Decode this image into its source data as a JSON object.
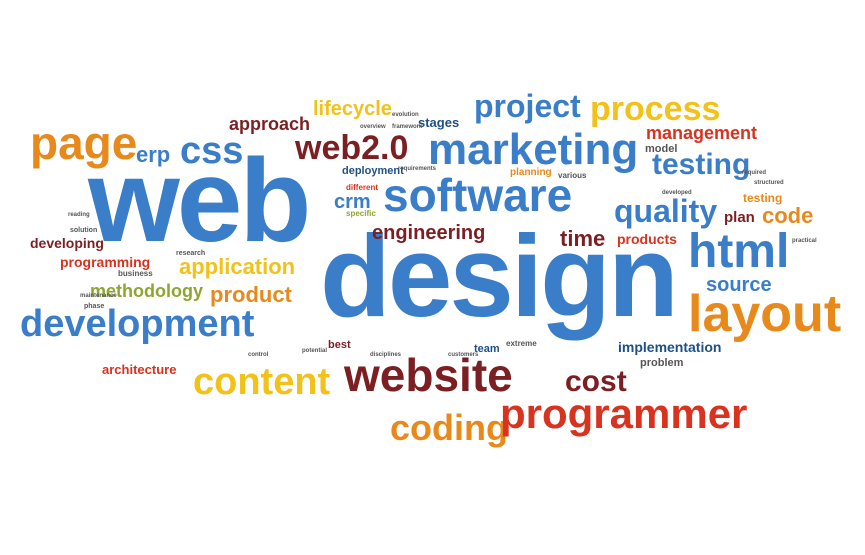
{
  "colors": {
    "blue": "#3a7dc9",
    "dark_red": "#7b1f22",
    "red": "#d9321f",
    "orange": "#e8891c",
    "yellow": "#f2c21a",
    "green": "#8fa531",
    "dark_blue": "#1f4f86",
    "gray": "#555555"
  },
  "words": {
    "web": "web",
    "design": "design",
    "website": "website",
    "software": "software",
    "marketing": "marketing",
    "project": "project",
    "process": "process",
    "lifecycle": "lifecycle",
    "approach": "approach",
    "stages": "stages",
    "management": "management",
    "page": "page",
    "erp": "erp",
    "css": "css",
    "web20": "web2.0",
    "deployment": "deployment",
    "testing": "testing",
    "testing_small": "testing",
    "model": "model",
    "crm": "crm",
    "quality": "quality",
    "code": "code",
    "plan": "plan",
    "engineering": "engineering",
    "time": "time",
    "products": "products",
    "html": "html",
    "source": "source",
    "layout": "layout",
    "developing": "developing",
    "programming": "programming",
    "application": "application",
    "methodology": "methodology",
    "product": "product",
    "development": "development",
    "implementation": "implementation",
    "problem": "problem",
    "architecture": "architecture",
    "content": "content",
    "cost": "cost",
    "coding": "coding",
    "programmer": "programmer",
    "best": "best",
    "team": "team",
    "extreme": "extreme",
    "planning": "planning",
    "various": "various",
    "different": "different",
    "specific": "specific",
    "requirements": "requirements",
    "business": "business",
    "phase": "phase",
    "maintenance": "maintenance",
    "research": "research",
    "solution": "solution",
    "reading": "reading",
    "evolution": "evolution",
    "overview": "overview",
    "framework": "framework",
    "developed": "developed",
    "structured": "structured",
    "customers": "customers",
    "disciplines": "disciplines",
    "practical": "practical",
    "required": "required",
    "potential": "potential",
    "control": "control"
  }
}
